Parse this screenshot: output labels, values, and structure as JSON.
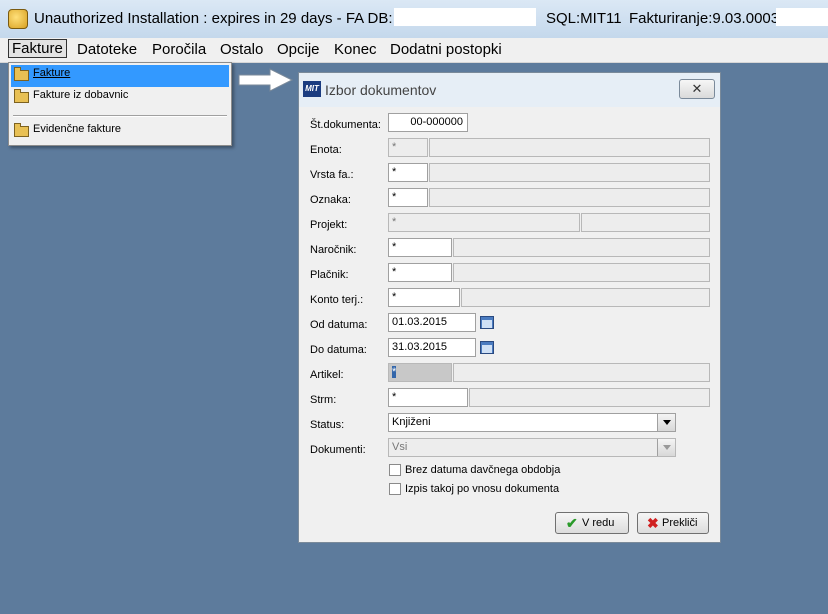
{
  "window": {
    "title": "Unauthorized Installation : expires in 29 days - FA    DB:",
    "sql": "SQL:MIT11",
    "version": "Fakturiranje:9.03.0003"
  },
  "menu": {
    "items": [
      "Fakture",
      "Datoteke",
      "Poročila",
      "Ostalo",
      "Opcije",
      "Konec",
      "Dodatni postopki"
    ]
  },
  "dropdown": {
    "items": [
      "Fakture",
      "Fakture iz dobavnic",
      "Evidenčne fakture"
    ]
  },
  "dialog": {
    "title": "Izbor dokumentov",
    "logo": "MIT",
    "close": "✕",
    "fields": {
      "st_dokumenta": {
        "label": "Št.dokumenta:",
        "value": "00-000000"
      },
      "enota": {
        "label": "Enota:",
        "value": "*"
      },
      "vrsta": {
        "label": "Vrsta fa.:",
        "value": "*"
      },
      "oznaka": {
        "label": "Oznaka:",
        "value": "*"
      },
      "projekt": {
        "label": "Projekt:",
        "value": "*"
      },
      "narocnik": {
        "label": "Naročnik:",
        "value": "*"
      },
      "placnik": {
        "label": "Plačnik:",
        "value": "*"
      },
      "konto": {
        "label": "Konto terj.:",
        "value": "*"
      },
      "od_datuma": {
        "label": "Od datuma:",
        "value": "01.03.2015"
      },
      "do_datuma": {
        "label": "Do datuma:",
        "value": "31.03.2015"
      },
      "artikel": {
        "label": "Artikel:",
        "value": "*"
      },
      "strm": {
        "label": "Strm:",
        "value": "*"
      },
      "status": {
        "label": "Status:",
        "value": "Knjiženi"
      },
      "dokumenti": {
        "label": "Dokumenti:",
        "value": "Vsi"
      }
    },
    "checkboxes": {
      "brez_datuma": {
        "label": "Brez datuma davčnega obdobja",
        "checked": false
      },
      "izpis": {
        "label": "Izpis takoj po vnosu dokumenta",
        "checked": false
      }
    },
    "buttons": {
      "ok": "V redu",
      "cancel": "Prekliči"
    }
  },
  "colors": {
    "desktop": "#5d7b9c",
    "selection": "#3399ff",
    "ok_icon": "#2a9a2a",
    "cancel_icon": "#d02020"
  }
}
